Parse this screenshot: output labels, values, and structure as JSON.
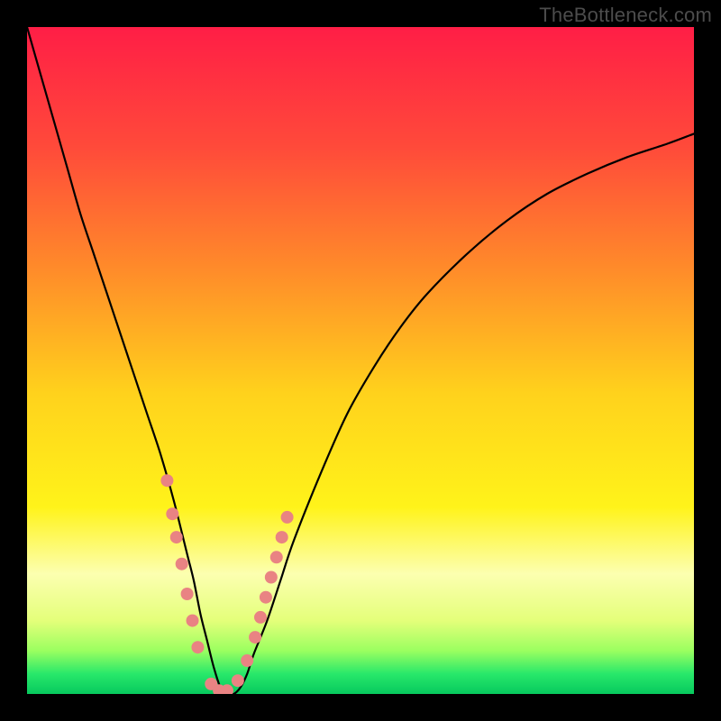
{
  "watermark": "TheBottleneck.com",
  "chart_data": {
    "type": "line",
    "title": "",
    "xlabel": "",
    "ylabel": "",
    "xlim": [
      0,
      100
    ],
    "ylim": [
      0,
      100
    ],
    "series": [
      {
        "name": "curve",
        "x": [
          0,
          2,
          4,
          6,
          8,
          10,
          12,
          14,
          16,
          18,
          20,
          22,
          24,
          25,
          26,
          27,
          28,
          29,
          30,
          31,
          32,
          33,
          34,
          36,
          38,
          40,
          44,
          48,
          52,
          56,
          60,
          66,
          72,
          78,
          84,
          90,
          96,
          100
        ],
        "y": [
          100,
          93,
          86,
          79,
          72,
          66,
          60,
          54,
          48,
          42,
          36,
          29,
          21,
          17,
          12,
          8,
          4,
          1,
          0,
          0,
          1,
          3,
          6,
          11,
          17,
          23,
          33,
          42,
          49,
          55,
          60,
          66,
          71,
          75,
          78,
          80.5,
          82.5,
          84
        ]
      }
    ],
    "markers": {
      "name": "points",
      "x": [
        21.0,
        21.8,
        22.4,
        23.2,
        24.0,
        24.8,
        25.6,
        27.6,
        28.8,
        30.0,
        31.6,
        33.0,
        34.2,
        35.0,
        35.8,
        36.6,
        37.4,
        38.2,
        39.0
      ],
      "y": [
        32.0,
        27.0,
        23.5,
        19.5,
        15.0,
        11.0,
        7.0,
        1.5,
        0.5,
        0.5,
        2.0,
        5.0,
        8.5,
        11.5,
        14.5,
        17.5,
        20.5,
        23.5,
        26.5
      ],
      "color": "#e98383",
      "radius": 7
    },
    "gradient": {
      "stops": [
        {
          "offset": 0.0,
          "color": "#ff1e46"
        },
        {
          "offset": 0.18,
          "color": "#ff4a3a"
        },
        {
          "offset": 0.36,
          "color": "#ff8a2a"
        },
        {
          "offset": 0.55,
          "color": "#ffd21c"
        },
        {
          "offset": 0.72,
          "color": "#fff31a"
        },
        {
          "offset": 0.82,
          "color": "#fcffb0"
        },
        {
          "offset": 0.89,
          "color": "#e4ff7a"
        },
        {
          "offset": 0.935,
          "color": "#9bff60"
        },
        {
          "offset": 0.97,
          "color": "#28e86a"
        },
        {
          "offset": 1.0,
          "color": "#07c95e"
        }
      ]
    }
  }
}
